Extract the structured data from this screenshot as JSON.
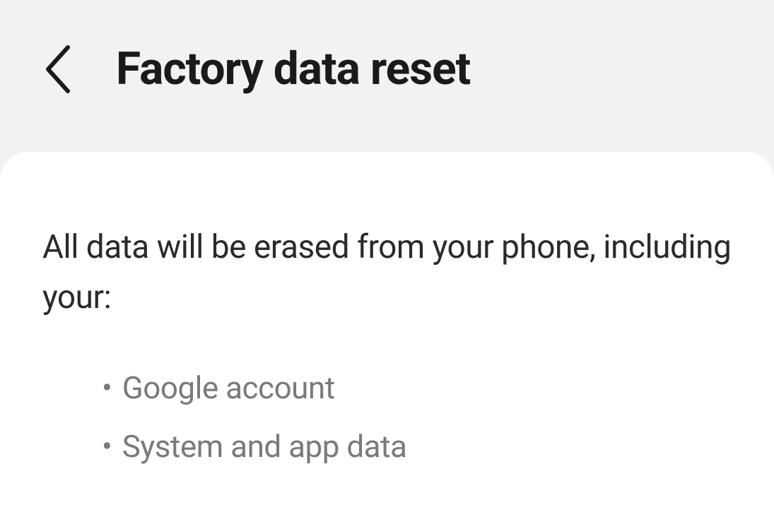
{
  "header": {
    "title": "Factory data reset"
  },
  "content": {
    "description": "All data will be erased from your phone, including your:",
    "items": [
      "Google account",
      "System and app data"
    ]
  }
}
